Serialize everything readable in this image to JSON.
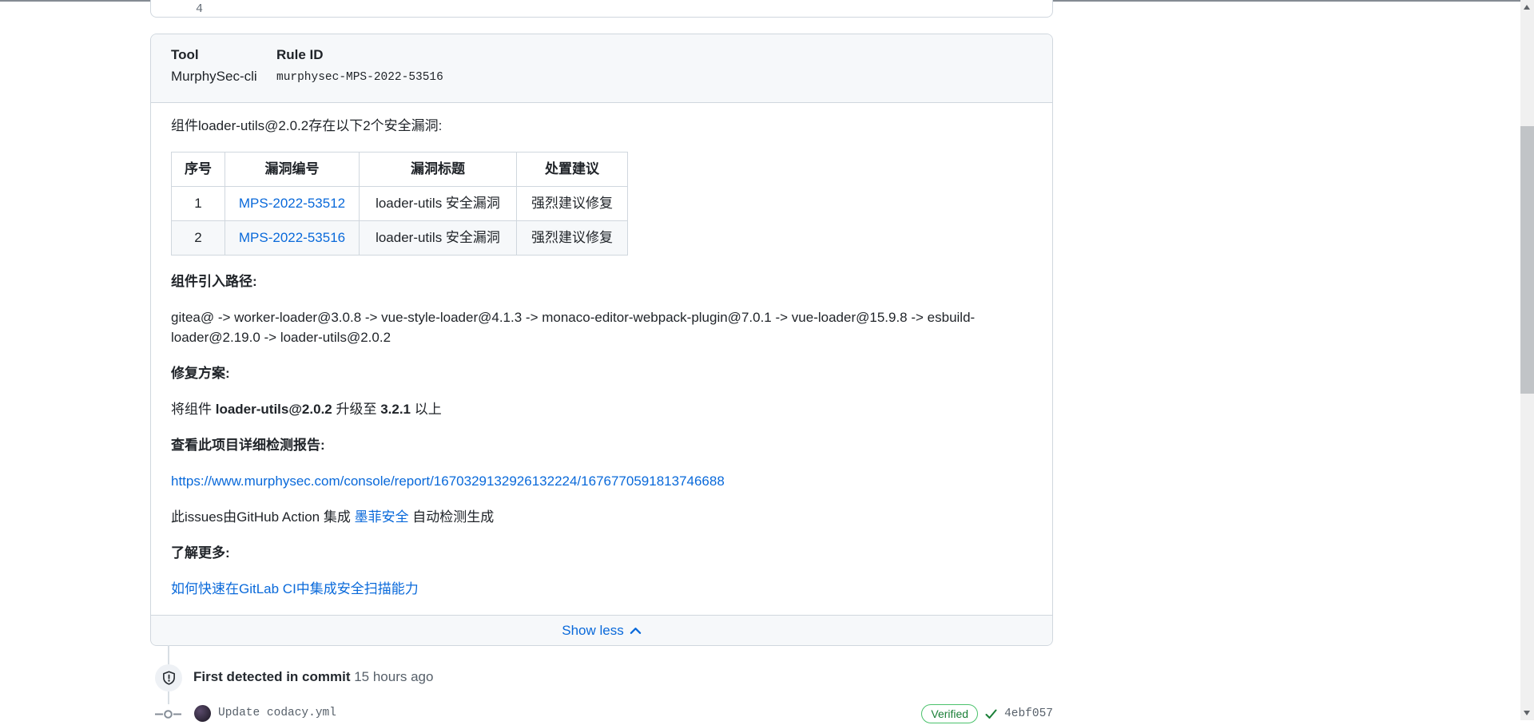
{
  "top_code": {
    "line_number": "4"
  },
  "card": {
    "header": {
      "tool_label": "Tool",
      "tool_value": "MurphySec-cli",
      "rule_id_label": "Rule ID",
      "rule_id_value": "murphysec-MPS-2022-53516"
    },
    "body": {
      "intro": "组件loader-utils@2.0.2存在以下2个安全漏洞:",
      "table": {
        "headers": [
          "序号",
          "漏洞编号",
          "漏洞标题",
          "处置建议"
        ],
        "rows": [
          {
            "index": "1",
            "vuln_id": "MPS-2022-53512",
            "title": "loader-utils 安全漏洞",
            "advice": "强烈建议修复"
          },
          {
            "index": "2",
            "vuln_id": "MPS-2022-53516",
            "title": "loader-utils 安全漏洞",
            "advice": "强烈建议修复"
          }
        ]
      },
      "path_heading": "组件引入路径:",
      "path_text": "gitea@ -> worker-loader@3.0.8 -> vue-style-loader@4.1.3 -> monaco-editor-webpack-plugin@7.0.1 -> vue-loader@15.9.8 -> esbuild-loader@2.19.0 -> loader-utils@2.0.2",
      "fix_heading": "修复方案:",
      "fix_prefix": "将组件 ",
      "fix_component": "loader-utils@2.0.2",
      "fix_middle": " 升级至 ",
      "fix_version": "3.2.1",
      "fix_suffix": " 以上",
      "report_heading": "查看此项目详细检测报告:",
      "report_url": "https://www.murphysec.com/console/report/1670329132926132224/1676770591813746688",
      "generated_prefix": "此issues由GitHub Action 集成 ",
      "generated_link": "墨菲安全",
      "generated_suffix": " 自动检测生成",
      "learn_more_heading": "了解更多:",
      "learn_more_link": "如何快速在GitLab CI中集成安全扫描能力"
    },
    "footer": {
      "show_less_label": "Show less"
    }
  },
  "timeline": {
    "detected_label": "First detected in commit",
    "detected_time": "15 hours ago",
    "commit_message": "Update codacy.yml",
    "verified_label": "Verified",
    "commit_sha": "4ebf057"
  },
  "colors": {
    "link_blue": "#0969da",
    "border_gray": "#d0d7de",
    "header_bg": "#f6f8fa",
    "verified_green": "#1a7f37"
  }
}
